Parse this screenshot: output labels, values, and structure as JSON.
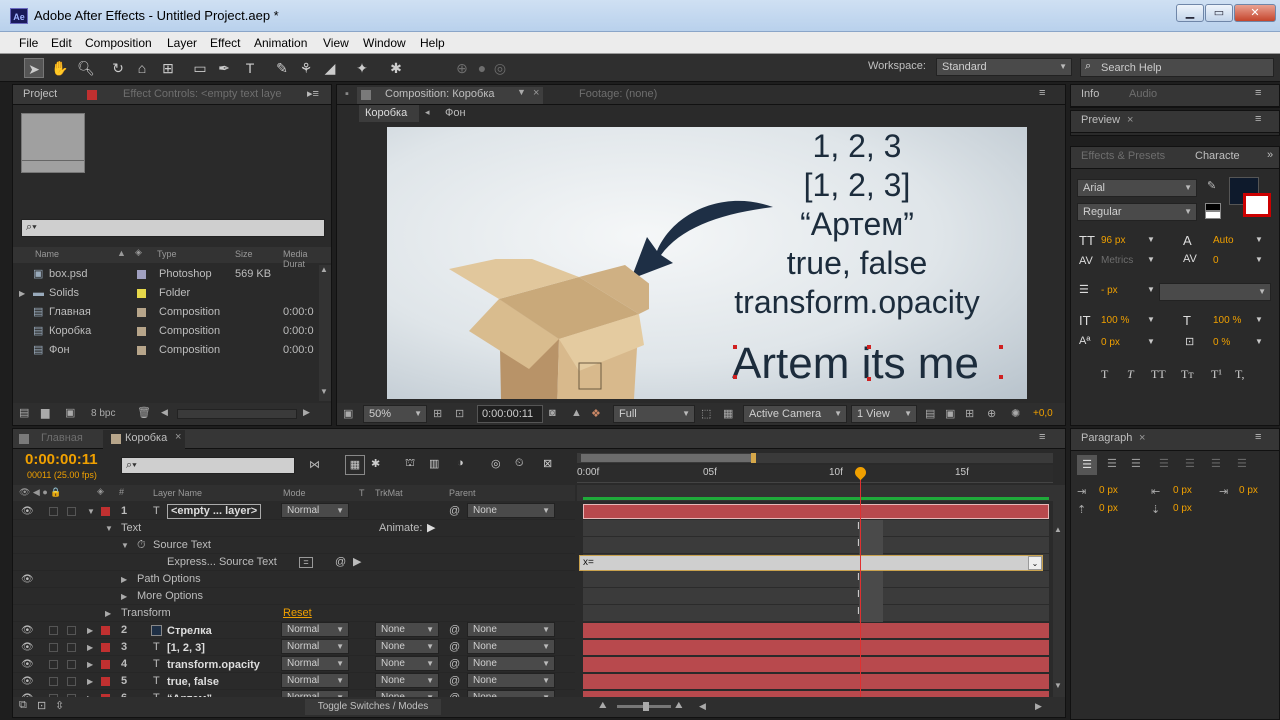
{
  "window": {
    "app_icon": "Ae",
    "title": "Adobe After Effects - Untitled Project.aep *",
    "min": "▁",
    "max": "▭",
    "close": "✕"
  },
  "menu": [
    "File",
    "Edit",
    "Composition",
    "Layer",
    "Effect",
    "Animation",
    "View",
    "Window",
    "Help"
  ],
  "toolbar": {
    "workspace_label": "Workspace:",
    "workspace_value": "Standard",
    "search_placeholder": "Search Help"
  },
  "project": {
    "tab": "Project",
    "effect_tab": "Effect Controls: <empty text laye",
    "search_glyph": "⌕▾",
    "columns": {
      "name": "Name",
      "type": "Type",
      "size": "Size",
      "duration": "Media Durat"
    },
    "items": [
      {
        "name": "box.psd",
        "type": "Photoshop",
        "size": "569 KB",
        "dur": "",
        "color": "#a0a0c0"
      },
      {
        "name": "Solids",
        "type": "Folder",
        "size": "",
        "dur": "",
        "color": "#e6d84a"
      },
      {
        "name": "Главная",
        "type": "Composition",
        "size": "",
        "dur": "0:00:0",
        "color": "#b7a58a"
      },
      {
        "name": "Коробка",
        "type": "Composition",
        "size": "",
        "dur": "0:00:0",
        "color": "#b7a58a"
      },
      {
        "name": "Фон",
        "type": "Composition",
        "size": "",
        "dur": "0:00:0",
        "color": "#b7a58a"
      }
    ],
    "bpc": "8 bpc"
  },
  "comp": {
    "tab": "Composition: Коробка",
    "footage_tab": "Footage: (none)",
    "breadcrumb_1": "Коробка",
    "breadcrumb_2": "Фон",
    "canvas_lines": [
      "1, 2, 3",
      "[1, 2, 3]",
      "“Артем”",
      "true, false",
      "transform.opacity"
    ],
    "big_text": "Artem its me",
    "footer": {
      "zoom": "50%",
      "time": "0:00:00:11",
      "resolution": "Full",
      "camera": "Active Camera",
      "view": "1 View",
      "exposure": "+0,0"
    }
  },
  "right": {
    "info": "Info",
    "audio": "Audio",
    "preview": "Preview",
    "effects": "Effects & Presets",
    "character": "Characte",
    "font": "Arial",
    "style": "Regular",
    "size": "96 px",
    "leading": "Auto",
    "kerning": "Metrics",
    "tracking": "0",
    "stroke": "- px",
    "vscale": "100 %",
    "hscale": "100 %",
    "baseline": "0 px",
    "tsume": "0 %",
    "styles": [
      "T",
      "T",
      "TT",
      "Tт",
      "T¹",
      "T,"
    ],
    "paragraph": "Paragraph",
    "para_px": [
      "0 px",
      "0 px",
      "0 px",
      "0 px",
      "0 px"
    ]
  },
  "timeline": {
    "tab1": "Главная",
    "tab2": "Коробка",
    "time": "0:00:00:11",
    "fps": "00011 (25.00 fps)",
    "cols": {
      "layer": "Layer Name",
      "mode": "Mode",
      "t": "T",
      "trk": "TrkMat",
      "parent": "Parent"
    },
    "ruler": [
      "0:00f",
      "05f",
      "10f",
      "15f"
    ],
    "layers": [
      {
        "num": "1",
        "name": "<empty ... layer>",
        "mode": "Normal",
        "trk": "",
        "parent": "None",
        "icon": "T"
      },
      {
        "num": "2",
        "name": "Стрелка",
        "mode": "Normal",
        "trk": "None",
        "parent": "None",
        "icon": "■"
      },
      {
        "num": "3",
        "name": "[1, 2, 3]",
        "mode": "Normal",
        "trk": "None",
        "parent": "None",
        "icon": "T"
      },
      {
        "num": "4",
        "name": "transform.opacity",
        "mode": "Normal",
        "trk": "None",
        "parent": "None",
        "icon": "T"
      },
      {
        "num": "5",
        "name": "true, false",
        "mode": "Normal",
        "trk": "None",
        "parent": "None",
        "icon": "T"
      },
      {
        "num": "6",
        "name": "“Артем”",
        "mode": "Normal",
        "trk": "None",
        "parent": "None",
        "icon": "T"
      }
    ],
    "props": {
      "text": "Text",
      "animate": "Animate:",
      "source_text": "Source Text",
      "expression": "Express... Source Text",
      "path": "Path Options",
      "more": "More Options",
      "transform": "Transform",
      "reset": "Reset"
    },
    "expr_value": "x=",
    "toggle": "Toggle Switches / Modes"
  },
  "colors": {
    "accent": "#f0a000",
    "layer_bar": "#b8494d",
    "playhead": "#e03030"
  }
}
